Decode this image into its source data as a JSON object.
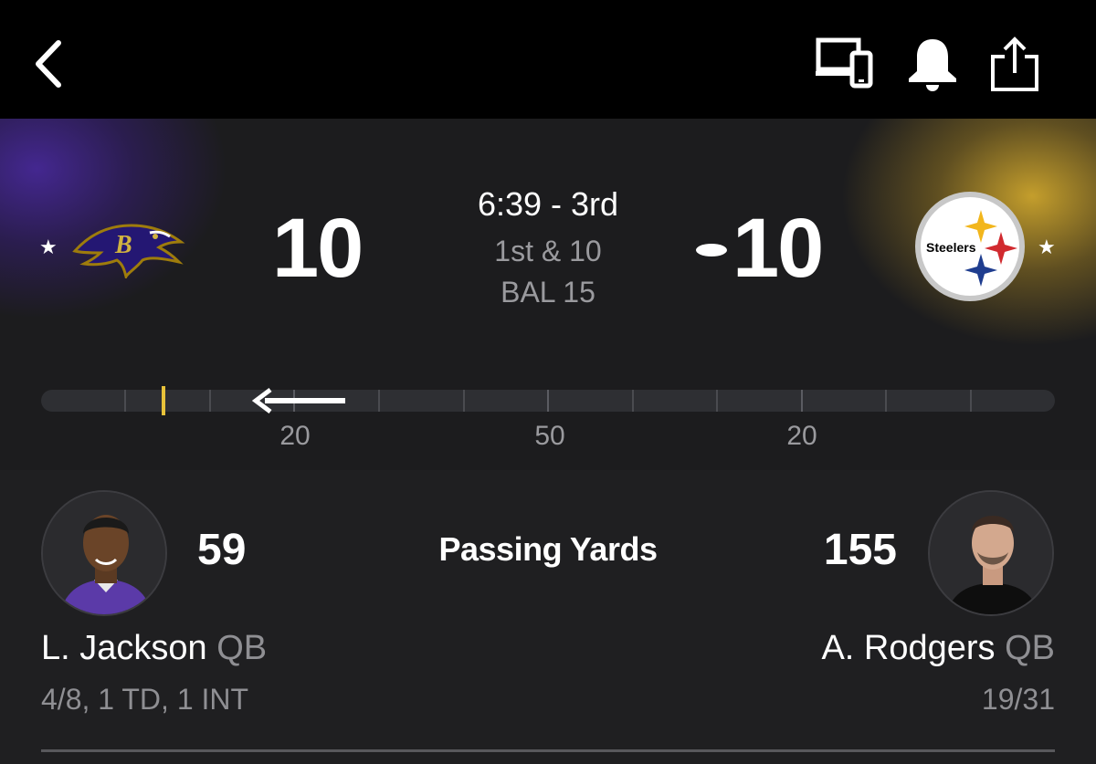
{
  "nav": {
    "back_icon": "chevron-left-icon",
    "icons": [
      "devices-icon",
      "bell-icon",
      "share-icon"
    ]
  },
  "game": {
    "home": {
      "score": "10",
      "logo": "ravens-logo",
      "favorite": "★",
      "color": "#4b2a96"
    },
    "away": {
      "score": "10",
      "logo": "steelers-logo",
      "logo_text": "Steelers",
      "favorite": "★",
      "color": "#d4a82e"
    },
    "clock": "6:39 - 3rd",
    "down_distance": "1st & 10",
    "ball_on": "BAL 15",
    "possession": "away"
  },
  "field": {
    "yard_labels": [
      "20",
      "50",
      "20"
    ],
    "line_of_scrimmage_color": "#e8c23a",
    "drive_direction": "left"
  },
  "leaders": {
    "category": "Passing Yards",
    "left": {
      "value": "59",
      "name": "L. Jackson",
      "position": "QB",
      "stats": "4/8, 1 TD, 1 INT"
    },
    "right": {
      "value": "155",
      "name": "A. Rodgers",
      "position": "QB",
      "stats": "19/31"
    }
  }
}
